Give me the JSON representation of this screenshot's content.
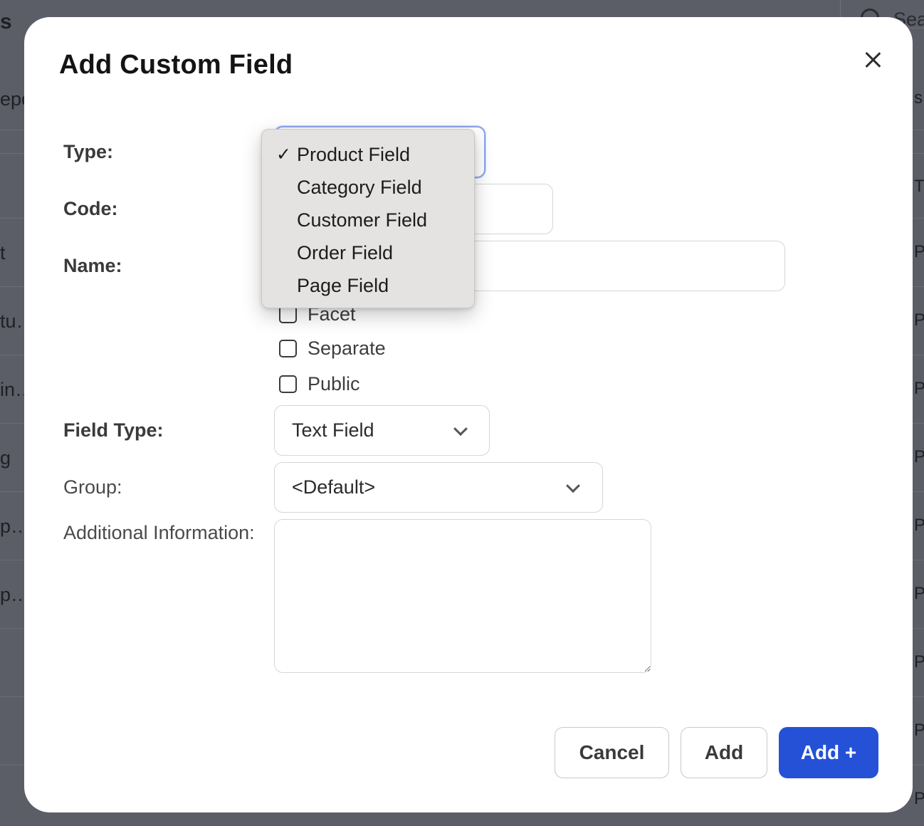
{
  "background": {
    "search_text": "Sea",
    "left_fragments": [
      "s",
      "epo",
      "t",
      "tu…",
      "in…",
      "g",
      "p…",
      "p…"
    ],
    "right_fragments": [
      "s",
      "T",
      "P",
      "P",
      "P",
      "P",
      "P",
      "P",
      "P",
      "P",
      "P"
    ]
  },
  "modal": {
    "title": "Add Custom Field",
    "labels": {
      "type": "Type:",
      "code": "Code:",
      "name": "Name:",
      "field_type": "Field Type:",
      "group": "Group:",
      "additional_info": "Additional Information:"
    },
    "type_select": {
      "selected": "Product Field",
      "options": [
        "Product Field",
        "Category Field",
        "Customer Field",
        "Order Field",
        "Page Field"
      ],
      "checkmark": "✓"
    },
    "code_value": "",
    "name_value": "",
    "checkboxes": [
      {
        "label": "Facet",
        "checked": false
      },
      {
        "label": "Separate",
        "checked": false
      },
      {
        "label": "Public",
        "checked": false
      }
    ],
    "field_type_value": "Text Field",
    "group_value": "<Default>",
    "additional_info_value": "",
    "buttons": {
      "cancel": "Cancel",
      "add": "Add",
      "add_plus": "Add +"
    },
    "colors": {
      "primary": "#2451d6",
      "focus_ring": "#8ea6f0",
      "menu_bg": "#e4e3e1"
    }
  }
}
